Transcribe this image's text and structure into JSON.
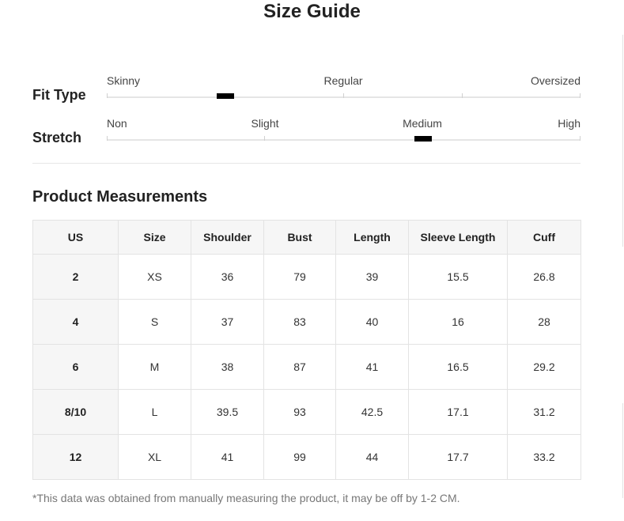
{
  "title": "Size Guide",
  "fit_type": {
    "label": "Fit Type",
    "points": [
      "Skinny",
      "Regular",
      "Oversized"
    ],
    "selected_position": 0.25
  },
  "stretch": {
    "label": "Stretch",
    "points": [
      "Non",
      "Slight",
      "Medium",
      "High"
    ],
    "selected_position": 0.667
  },
  "measurements": {
    "title": "Product Measurements",
    "headers": [
      "US",
      "Size",
      "Shoulder",
      "Bust",
      "Length",
      "Sleeve Length",
      "Cuff"
    ],
    "rows": [
      [
        "2",
        "XS",
        "36",
        "79",
        "39",
        "15.5",
        "26.8"
      ],
      [
        "4",
        "S",
        "37",
        "83",
        "40",
        "16",
        "28"
      ],
      [
        "6",
        "M",
        "38",
        "87",
        "41",
        "16.5",
        "29.2"
      ],
      [
        "8/10",
        "L",
        "39.5",
        "93",
        "42.5",
        "17.1",
        "31.2"
      ],
      [
        "12",
        "XL",
        "41",
        "99",
        "44",
        "17.7",
        "33.2"
      ]
    ]
  },
  "footnote": "*This data was obtained from manually measuring the product, it may be off by 1-2 CM."
}
